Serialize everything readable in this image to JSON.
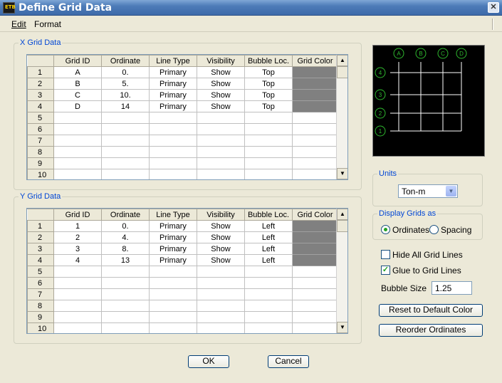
{
  "window": {
    "title": "Define Grid Data"
  },
  "menu": {
    "edit": "Edit",
    "format": "Format"
  },
  "x_grid": {
    "legend": "X Grid Data",
    "headers": [
      "Grid ID",
      "Ordinate",
      "Line Type",
      "Visibility",
      "Bubble Loc.",
      "Grid Color"
    ],
    "rows": [
      [
        "1",
        "A",
        "0.",
        "Primary",
        "Show",
        "Top"
      ],
      [
        "2",
        "B",
        "5.",
        "Primary",
        "Show",
        "Top"
      ],
      [
        "3",
        "C",
        "10.",
        "Primary",
        "Show",
        "Top"
      ],
      [
        "4",
        "D",
        "14",
        "Primary",
        "Show",
        "Top"
      ],
      [
        "5",
        "",
        "",
        "",
        "",
        ""
      ],
      [
        "6",
        "",
        "",
        "",
        "",
        ""
      ],
      [
        "7",
        "",
        "",
        "",
        "",
        ""
      ],
      [
        "8",
        "",
        "",
        "",
        "",
        ""
      ],
      [
        "9",
        "",
        "",
        "",
        "",
        ""
      ],
      [
        "10",
        "",
        "",
        "",
        "",
        ""
      ]
    ]
  },
  "y_grid": {
    "legend": "Y Grid Data",
    "headers": [
      "Grid ID",
      "Ordinate",
      "Line Type",
      "Visibility",
      "Bubble Loc.",
      "Grid Color"
    ],
    "rows": [
      [
        "1",
        "1",
        "0.",
        "Primary",
        "Show",
        "Left"
      ],
      [
        "2",
        "2",
        "4.",
        "Primary",
        "Show",
        "Left"
      ],
      [
        "3",
        "3",
        "8.",
        "Primary",
        "Show",
        "Left"
      ],
      [
        "4",
        "4",
        "13",
        "Primary",
        "Show",
        "Left"
      ],
      [
        "5",
        "",
        "",
        "",
        "",
        ""
      ],
      [
        "6",
        "",
        "",
        "",
        "",
        ""
      ],
      [
        "7",
        "",
        "",
        "",
        "",
        ""
      ],
      [
        "8",
        "",
        "",
        "",
        "",
        ""
      ],
      [
        "9",
        "",
        "",
        "",
        "",
        ""
      ],
      [
        "10",
        "",
        "",
        "",
        "",
        ""
      ]
    ]
  },
  "preview": {
    "x_labels": [
      "A",
      "B",
      "C",
      "D"
    ],
    "y_labels": [
      "4",
      "3",
      "2",
      "1"
    ],
    "line_color": "#ffffff",
    "bubble_color": "#2eb82e"
  },
  "units": {
    "legend": "Units",
    "selected": "Ton-m"
  },
  "display_grids": {
    "legend": "Display Grids as",
    "ordinates": "Ordinates",
    "spacing": "Spacing",
    "selected": "ordinates"
  },
  "options": {
    "hide_all": "Hide All Grid Lines",
    "hide_all_checked": false,
    "glue": "Glue to Grid Lines",
    "glue_checked": true
  },
  "bubble": {
    "label": "Bubble Size",
    "value": "1.25"
  },
  "buttons": {
    "reset": "Reset to Default Color",
    "reorder": "Reorder Ordinates",
    "ok": "OK",
    "cancel": "Cancel"
  },
  "colors": {
    "title_bar": "#3d6aa9",
    "window_bg": "#ece9d8",
    "group_label": "#0046d5",
    "grid_color_cell": "#808080",
    "preview_bg": "#000000"
  }
}
